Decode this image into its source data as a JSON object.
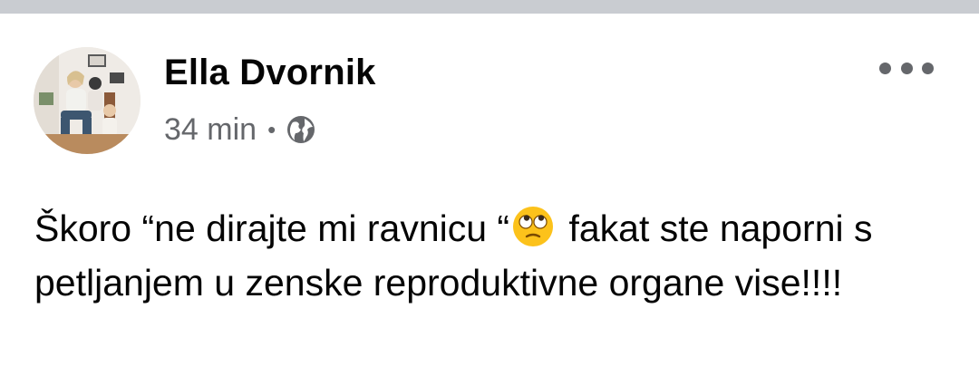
{
  "post": {
    "author": "Ella Dvornik",
    "time": "34 min",
    "separator": "•",
    "privacy_icon": "globe-icon",
    "options_icon": "more-horizontal-icon",
    "message_part1": "Škoro “ne dirajte mi ravnicu “",
    "emoji_icon": "face-with-rolling-eyes-icon",
    "message_part2": " fakat ste naporni s petljanjem u zenske reproduktivne organe vise!!!!"
  },
  "colors": {
    "top_strip": "#c9ccd1",
    "secondary_text": "#65676b",
    "primary_text": "#050505"
  }
}
